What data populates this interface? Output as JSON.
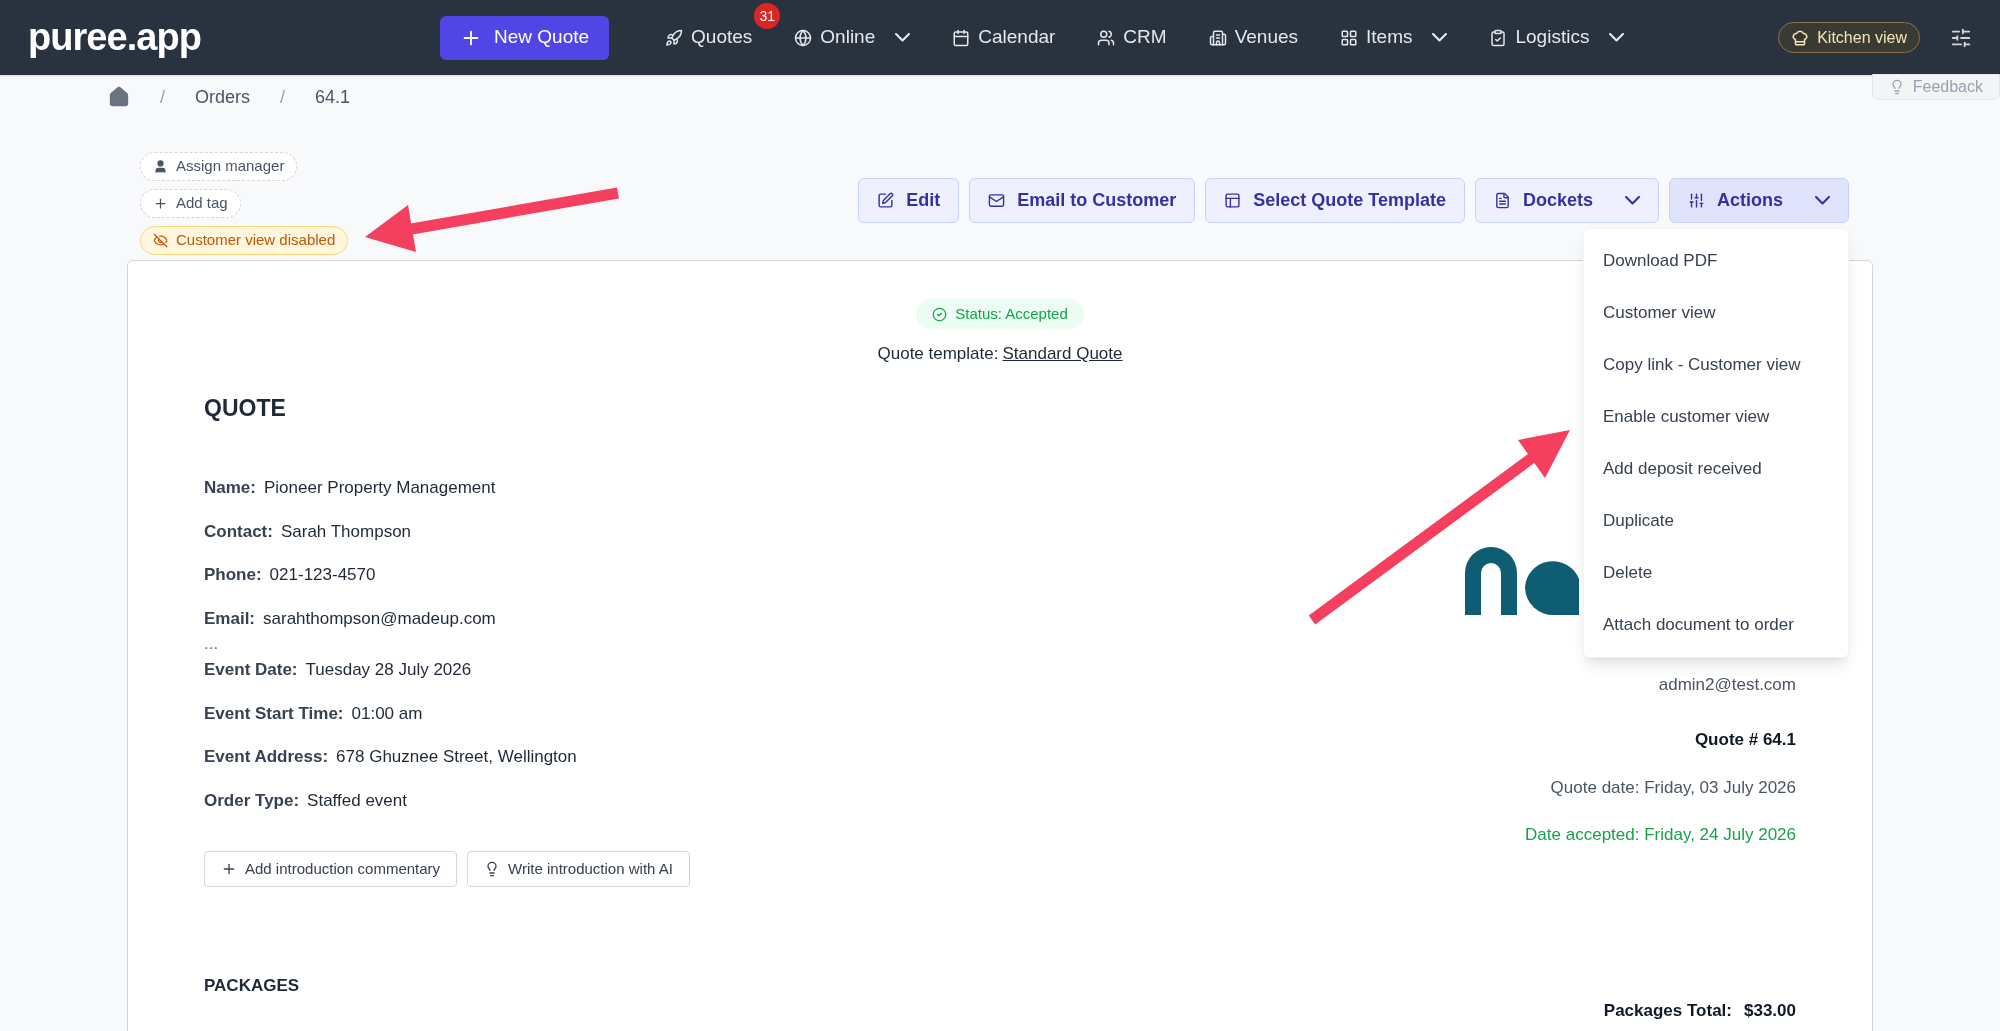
{
  "nav": {
    "logo": "puree.app",
    "new_quote": "New Quote",
    "items": [
      {
        "kind": "rocket",
        "label": "Quotes",
        "badge": "31",
        "dropdown": false
      },
      {
        "kind": "globe",
        "label": "Online",
        "dropdown": true
      },
      {
        "kind": "calendar",
        "label": "Calendar",
        "dropdown": false
      },
      {
        "kind": "users",
        "label": "CRM",
        "dropdown": false
      },
      {
        "kind": "building",
        "label": "Venues",
        "dropdown": false
      },
      {
        "kind": "grid",
        "label": "Items",
        "dropdown": true
      },
      {
        "kind": "clipboard",
        "label": "Logistics",
        "dropdown": true
      }
    ],
    "kitchen_view": "Kitchen view"
  },
  "breadcrumb": [
    "Orders",
    "64.1"
  ],
  "breadcrumb_separator": "/",
  "feedback": "Feedback",
  "tags": [
    {
      "kind": "manager",
      "label": "Assign manager"
    },
    {
      "kind": "add",
      "label": "Add tag"
    },
    {
      "kind": "warning",
      "label": "Customer view disabled"
    }
  ],
  "toolbar": [
    {
      "kind": "edit",
      "label": "Edit",
      "dropdown": false,
      "expanded": false
    },
    {
      "kind": "mail",
      "label": "Email to Customer",
      "dropdown": false,
      "expanded": false
    },
    {
      "kind": "template",
      "label": "Select Quote Template",
      "dropdown": false,
      "expanded": false
    },
    {
      "kind": "file",
      "label": "Dockets",
      "dropdown": true,
      "expanded": false
    },
    {
      "kind": "actions",
      "label": "Actions",
      "dropdown": true,
      "expanded": true
    }
  ],
  "actions_menu": [
    "Download PDF",
    "Customer view",
    "Copy link - Customer view",
    "Enable customer view",
    "Add deposit received",
    "Duplicate",
    "Delete",
    "Attach document to order"
  ],
  "quote": {
    "status": "Status: Accepted",
    "template_label": "Quote template:",
    "template_link": "Standard Quote",
    "title": "QUOTE",
    "fields": [
      {
        "label": "Name:",
        "value": "Pioneer Property Management"
      },
      {
        "label": "Contact:",
        "value": "Sarah Thompson"
      },
      {
        "label": "Phone:",
        "value": "021-123-4570"
      },
      {
        "label": "Email:",
        "value": "sarahthompson@madeup.com"
      }
    ],
    "ellipsis": "...",
    "event_fields": [
      {
        "label": "Event Date:",
        "value": "Tuesday 28 July 2026"
      },
      {
        "label": "Event Start Time:",
        "value": "01:00 am"
      },
      {
        "label": "Event Address:",
        "value": "678 Ghuznee Street, Wellington"
      },
      {
        "label": "Order Type:",
        "value": "Staffed event"
      }
    ],
    "intro_buttons": [
      {
        "kind": "add",
        "label": "Add introduction commentary"
      },
      {
        "kind": "ai",
        "label": "Write introduction with AI"
      }
    ],
    "company_email": "admin2@test.com",
    "quote_number": "Quote # 64.1",
    "quote_date": "Quote date: Friday, 03 July 2026",
    "date_accepted": "Date accepted: Friday, 24 July 2026",
    "packages_heading": "PACKAGES",
    "packages_total_label": "Packages Total:",
    "packages_total_value": "$33.00"
  }
}
